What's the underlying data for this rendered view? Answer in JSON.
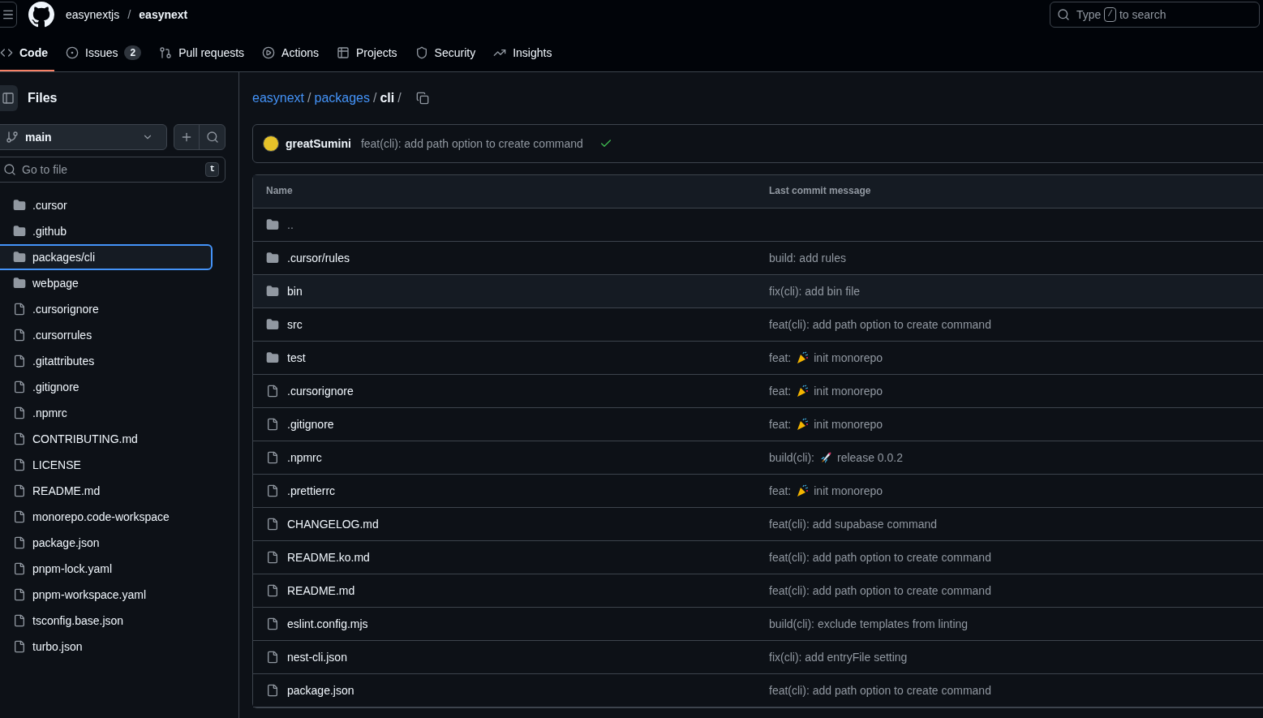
{
  "header": {
    "owner": "easynextjs",
    "separator": "/",
    "repo": "easynext",
    "search": {
      "placeholder_before": "Type",
      "key": "/",
      "placeholder_after": "to search"
    }
  },
  "tabs": [
    {
      "label": "Code",
      "kind": "code",
      "selected": true
    },
    {
      "label": "Issues",
      "kind": "issue",
      "count": "2",
      "selected": false
    },
    {
      "label": "Pull requests",
      "kind": "pr",
      "selected": false
    },
    {
      "label": "Actions",
      "kind": "play",
      "selected": false
    },
    {
      "label": "Projects",
      "kind": "table",
      "selected": false
    },
    {
      "label": "Security",
      "kind": "shield",
      "selected": false
    },
    {
      "label": "Insights",
      "kind": "graph",
      "selected": false
    }
  ],
  "sidebar": {
    "title": "Files",
    "branch": "main",
    "filter_placeholder": "Go to file",
    "filter_key": "t",
    "items": [
      {
        "name": ".cursor",
        "kind": "folder",
        "selected": false
      },
      {
        "name": ".github",
        "kind": "folder",
        "selected": false
      },
      {
        "name": "packages/cli",
        "kind": "folder",
        "selected": true
      },
      {
        "name": "webpage",
        "kind": "folder",
        "selected": false
      },
      {
        "name": ".cursorignore",
        "kind": "file",
        "selected": false
      },
      {
        "name": ".cursorrules",
        "kind": "file",
        "selected": false
      },
      {
        "name": ".gitattributes",
        "kind": "file",
        "selected": false
      },
      {
        "name": ".gitignore",
        "kind": "file",
        "selected": false
      },
      {
        "name": ".npmrc",
        "kind": "file",
        "selected": false
      },
      {
        "name": "CONTRIBUTING.md",
        "kind": "file",
        "selected": false
      },
      {
        "name": "LICENSE",
        "kind": "file",
        "selected": false
      },
      {
        "name": "README.md",
        "kind": "file",
        "selected": false
      },
      {
        "name": "monorepo.code-workspace",
        "kind": "file",
        "selected": false
      },
      {
        "name": "package.json",
        "kind": "file",
        "selected": false
      },
      {
        "name": "pnpm-lock.yaml",
        "kind": "file",
        "selected": false
      },
      {
        "name": "pnpm-workspace.yaml",
        "kind": "file",
        "selected": false
      },
      {
        "name": "tsconfig.base.json",
        "kind": "file",
        "selected": false
      },
      {
        "name": "turbo.json",
        "kind": "file",
        "selected": false
      }
    ]
  },
  "breadcrumb": {
    "links": [
      "easynext",
      "packages"
    ],
    "current": "cli",
    "separator": "/"
  },
  "latest_commit": {
    "author": "greatSumini",
    "message": "feat(cli): add path option to create command",
    "checks_passed": true
  },
  "table": {
    "columns": [
      "Name",
      "Last commit message"
    ],
    "rows": [
      {
        "name": "..",
        "kind": "folder",
        "highlighted": false,
        "message": []
      },
      {
        "name": ".cursor/rules",
        "kind": "folder",
        "highlighted": false,
        "message": [
          {
            "kind": "text",
            "text": "build: add rules"
          }
        ]
      },
      {
        "name": "bin",
        "kind": "folder",
        "highlighted": true,
        "message": [
          {
            "kind": "text",
            "text": "fix(cli): add bin file"
          }
        ]
      },
      {
        "name": "src",
        "kind": "folder",
        "highlighted": false,
        "message": [
          {
            "kind": "text",
            "text": "feat(cli): add path option to create command"
          }
        ]
      },
      {
        "name": "test",
        "kind": "folder",
        "highlighted": false,
        "message": [
          {
            "kind": "text",
            "text": "feat:"
          },
          {
            "kind": "party"
          },
          {
            "kind": "text",
            "text": "init monorepo"
          }
        ]
      },
      {
        "name": ".cursorignore",
        "kind": "file",
        "highlighted": false,
        "message": [
          {
            "kind": "text",
            "text": "feat:"
          },
          {
            "kind": "party"
          },
          {
            "kind": "text",
            "text": "init monorepo"
          }
        ]
      },
      {
        "name": ".gitignore",
        "kind": "file",
        "highlighted": false,
        "message": [
          {
            "kind": "text",
            "text": "feat:"
          },
          {
            "kind": "party"
          },
          {
            "kind": "text",
            "text": "init monorepo"
          }
        ]
      },
      {
        "name": ".npmrc",
        "kind": "file",
        "highlighted": false,
        "message": [
          {
            "kind": "text",
            "text": "build(cli):"
          },
          {
            "kind": "rocket"
          },
          {
            "kind": "text",
            "text": "release 0.0.2"
          }
        ]
      },
      {
        "name": ".prettierrc",
        "kind": "file",
        "highlighted": false,
        "message": [
          {
            "kind": "text",
            "text": "feat:"
          },
          {
            "kind": "party"
          },
          {
            "kind": "text",
            "text": "init monorepo"
          }
        ]
      },
      {
        "name": "CHANGELOG.md",
        "kind": "file",
        "highlighted": false,
        "message": [
          {
            "kind": "text",
            "text": "feat(cli): add supabase command"
          }
        ]
      },
      {
        "name": "README.ko.md",
        "kind": "file",
        "highlighted": false,
        "message": [
          {
            "kind": "text",
            "text": "feat(cli): add path option to create command"
          }
        ]
      },
      {
        "name": "README.md",
        "kind": "file",
        "highlighted": false,
        "message": [
          {
            "kind": "text",
            "text": "feat(cli): add path option to create command"
          }
        ]
      },
      {
        "name": "eslint.config.mjs",
        "kind": "file",
        "highlighted": false,
        "message": [
          {
            "kind": "text",
            "text": "build(cli): exclude templates from linting"
          }
        ]
      },
      {
        "name": "nest-cli.json",
        "kind": "file",
        "highlighted": false,
        "message": [
          {
            "kind": "text",
            "text": "fix(cli): add entryFile setting"
          }
        ]
      },
      {
        "name": "package.json",
        "kind": "file",
        "highlighted": false,
        "message": [
          {
            "kind": "text",
            "text": "feat(cli): add path option to create command"
          }
        ]
      }
    ]
  }
}
